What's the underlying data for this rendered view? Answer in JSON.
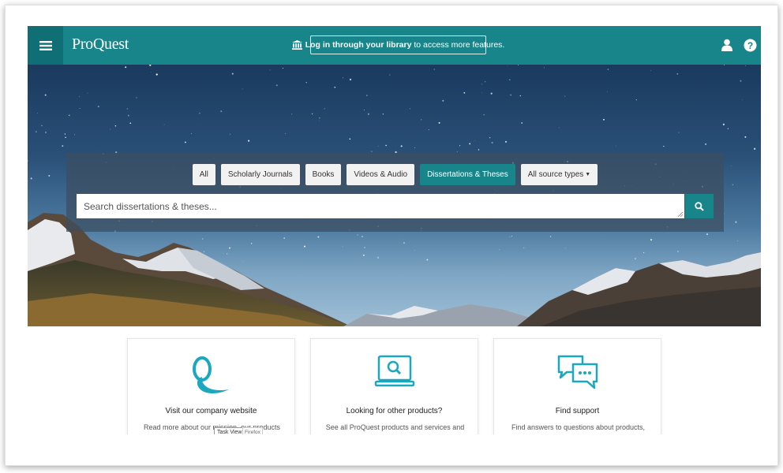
{
  "header": {
    "logo": "ProQuest",
    "login_bold": "Log in through your library",
    "login_rest": " to access more features.",
    "icons": [
      "menu-icon",
      "bank-icon",
      "user-icon",
      "help-icon"
    ]
  },
  "search": {
    "tabs": [
      {
        "label": "All",
        "active": false
      },
      {
        "label": "Scholarly Journals",
        "active": false
      },
      {
        "label": "Books",
        "active": false
      },
      {
        "label": "Videos & Audio",
        "active": false
      },
      {
        "label": "Dissertations & Theses",
        "active": true
      },
      {
        "label": "All source types",
        "active": false,
        "dropdown": true
      }
    ],
    "placeholder": "Search dissertations & theses...",
    "value": ""
  },
  "cards": [
    {
      "icon": "proquest-q-logo-icon",
      "title": "Visit our company website",
      "text": "Read more about our mission, our products"
    },
    {
      "icon": "laptop-search-icon",
      "title": "Looking for other products?",
      "text": "See all ProQuest products and services and"
    },
    {
      "icon": "chat-bubbles-icon",
      "title": "Find support",
      "text": "Find answers to questions about products,"
    }
  ],
  "taskbar": {
    "task_view": "Task View",
    "firefox": "Firefox"
  },
  "colors": {
    "teal": "#17858a",
    "teal_dark": "#0f6f74",
    "icon_teal": "#1aa7c0"
  }
}
